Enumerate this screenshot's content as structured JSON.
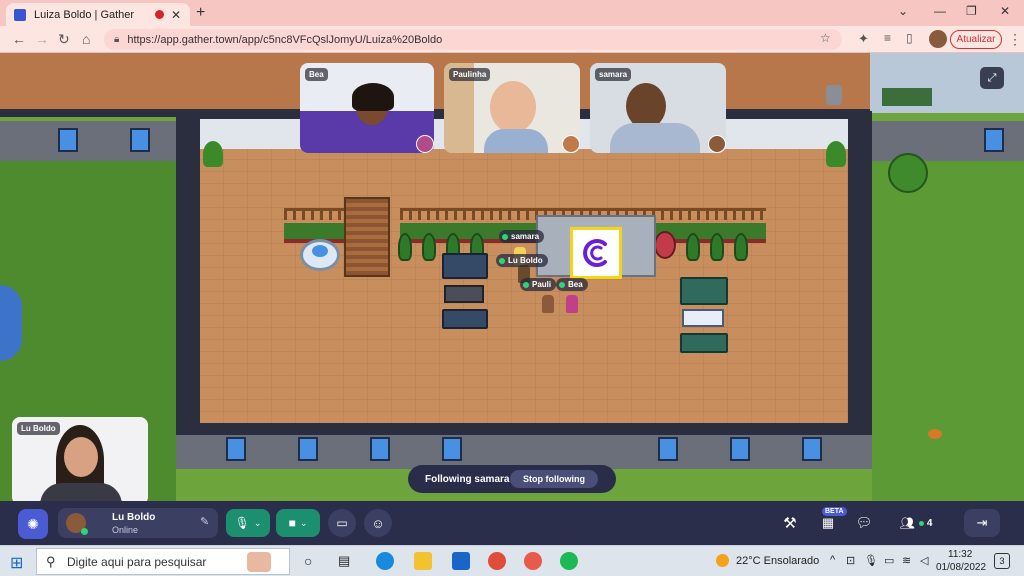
{
  "browser": {
    "tab_title": "Luiza Boldo | Gather",
    "url": "https://app.gather.town/app/c5nc8VFcQslJomyU/Luiza%20Boldo",
    "update_label": "Atualizar"
  },
  "videos": [
    {
      "name": "Bea"
    },
    {
      "name": "Paulinha"
    },
    {
      "name": "samara"
    }
  ],
  "self_video": {
    "name": "Lu Boldo"
  },
  "map": {
    "nametags": [
      "samara",
      "Lu Boldo",
      "Pauli",
      "Bea"
    ]
  },
  "following": {
    "text": "Following samara",
    "stop_label": "Stop following"
  },
  "bottombar": {
    "user_name": "Lu Boldo",
    "user_status": "Online",
    "calendar_badge": "BETA",
    "participants_count": "4"
  },
  "taskbar": {
    "search_placeholder": "Digite aqui para pesquisar",
    "weather": "22°C  Ensolarado",
    "time": "11:32",
    "date": "01/08/2022",
    "notification_count": "3"
  },
  "colors": {
    "accent": "#4a5bd4",
    "mic_green": "#1b8f6e",
    "online_dot": "#2fd47a",
    "record_red": "#d4242a"
  }
}
